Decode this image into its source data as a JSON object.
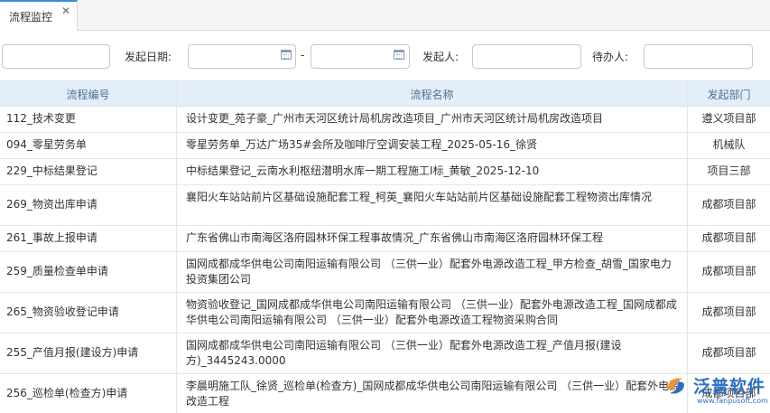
{
  "tab": {
    "label": "流程监控",
    "close": "✕"
  },
  "filter": {
    "start_date_label": "发起日期:",
    "range_separator": "-",
    "initiator_label": "发起人:",
    "pending_label": "待办人:"
  },
  "table": {
    "columns": [
      "流程编号",
      "流程名称",
      "发起部门"
    ],
    "rows": [
      {
        "id": "112_技术变更",
        "name": "设计变更_苑子豪_广州市天河区统计局机房改造项目_广州市天河区统计局机房改造项目",
        "dept": "遵义项目部"
      },
      {
        "id": "094_零星劳务单",
        "name": "零星劳务单_万达广场35#会所及咖啡厅空调安装工程_2025-05-16_徐贤",
        "dept": "机械队"
      },
      {
        "id": "229_中标结果登记",
        "name": "中标结果登记_云南水利枢纽潜明水库一期工程施工I标_黄敏_2025-12-10",
        "dept": "项目三部"
      },
      {
        "id": "269_物资出库申请",
        "name": "襄阳火车站站前片区基础设施配套工程_柯英_襄阳火车站站前片区基础设施配套工程物资出库情况",
        "dept": "成都项目部"
      },
      {
        "id": "261_事故上报申请",
        "name": "广东省佛山市南海区洛府园林环保工程事故情况_广东省佛山市南海区洛府园林环保工程",
        "dept": "成都项目部"
      },
      {
        "id": "259_质量检查单申请",
        "name": "国网成都成华供电公司南阳运输有限公司 （三供一业）配套外电源改造工程_甲方检查_胡雪_国家电力投资集团公司",
        "dept": "成都项目部"
      },
      {
        "id": "265_物资验收登记申请",
        "name": "物资验收登记_国网成都成华供电公司南阳运输有限公司 （三供一业）配套外电源改造工程_国网成都成华供电公司南阳运输有限公司 （三供一业）配套外电源改造工程物资采购合同",
        "dept": "成都项目部"
      },
      {
        "id": "255_产值月报(建设方)申请",
        "name": "国网成都成华供电公司南阳运输有限公司 （三供一业）配套外电源改造工程_产值月报(建设方)_3445243.0000",
        "dept": "成都项目部"
      },
      {
        "id": "256_巡检单(检查方)申请",
        "name": "李晨明施工队_徐贤_巡检单(检查方)_国网成都成华供电公司南阳运输有限公司 （三供一业）配套外电源改造工程",
        "dept": "成都项目部"
      }
    ]
  },
  "watermark": {
    "brand": "泛普软件",
    "url": "www.fanpusoft.com"
  },
  "colors": {
    "accent": "#3c8dde",
    "header_bg": "#e3eef8",
    "header_text": "#4d6f94",
    "brand": "#2b6fc2"
  }
}
